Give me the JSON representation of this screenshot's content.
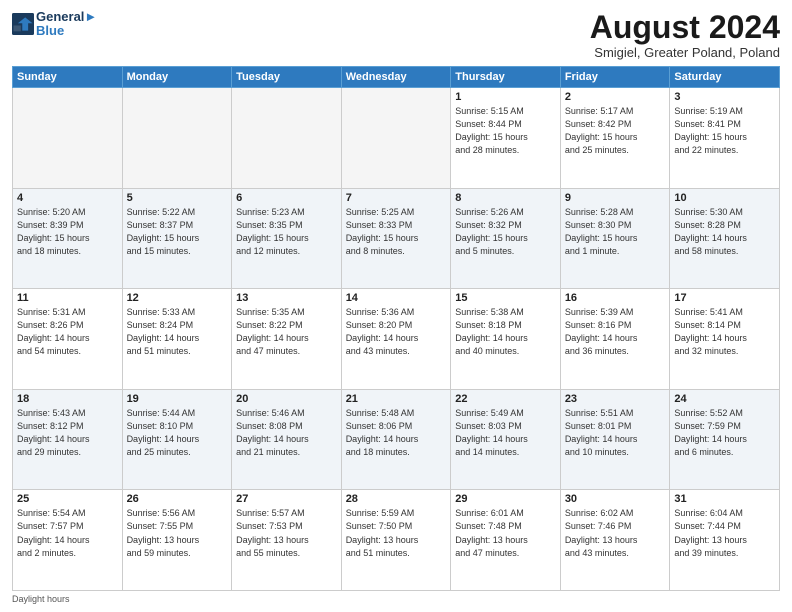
{
  "header": {
    "logo_line1": "General",
    "logo_line2": "Blue",
    "month_title": "August 2024",
    "subtitle": "Smigiel, Greater Poland, Poland"
  },
  "weekdays": [
    "Sunday",
    "Monday",
    "Tuesday",
    "Wednesday",
    "Thursday",
    "Friday",
    "Saturday"
  ],
  "weeks": [
    [
      {
        "day": "",
        "info": ""
      },
      {
        "day": "",
        "info": ""
      },
      {
        "day": "",
        "info": ""
      },
      {
        "day": "",
        "info": ""
      },
      {
        "day": "1",
        "info": "Sunrise: 5:15 AM\nSunset: 8:44 PM\nDaylight: 15 hours\nand 28 minutes."
      },
      {
        "day": "2",
        "info": "Sunrise: 5:17 AM\nSunset: 8:42 PM\nDaylight: 15 hours\nand 25 minutes."
      },
      {
        "day": "3",
        "info": "Sunrise: 5:19 AM\nSunset: 8:41 PM\nDaylight: 15 hours\nand 22 minutes."
      }
    ],
    [
      {
        "day": "4",
        "info": "Sunrise: 5:20 AM\nSunset: 8:39 PM\nDaylight: 15 hours\nand 18 minutes."
      },
      {
        "day": "5",
        "info": "Sunrise: 5:22 AM\nSunset: 8:37 PM\nDaylight: 15 hours\nand 15 minutes."
      },
      {
        "day": "6",
        "info": "Sunrise: 5:23 AM\nSunset: 8:35 PM\nDaylight: 15 hours\nand 12 minutes."
      },
      {
        "day": "7",
        "info": "Sunrise: 5:25 AM\nSunset: 8:33 PM\nDaylight: 15 hours\nand 8 minutes."
      },
      {
        "day": "8",
        "info": "Sunrise: 5:26 AM\nSunset: 8:32 PM\nDaylight: 15 hours\nand 5 minutes."
      },
      {
        "day": "9",
        "info": "Sunrise: 5:28 AM\nSunset: 8:30 PM\nDaylight: 15 hours\nand 1 minute."
      },
      {
        "day": "10",
        "info": "Sunrise: 5:30 AM\nSunset: 8:28 PM\nDaylight: 14 hours\nand 58 minutes."
      }
    ],
    [
      {
        "day": "11",
        "info": "Sunrise: 5:31 AM\nSunset: 8:26 PM\nDaylight: 14 hours\nand 54 minutes."
      },
      {
        "day": "12",
        "info": "Sunrise: 5:33 AM\nSunset: 8:24 PM\nDaylight: 14 hours\nand 51 minutes."
      },
      {
        "day": "13",
        "info": "Sunrise: 5:35 AM\nSunset: 8:22 PM\nDaylight: 14 hours\nand 47 minutes."
      },
      {
        "day": "14",
        "info": "Sunrise: 5:36 AM\nSunset: 8:20 PM\nDaylight: 14 hours\nand 43 minutes."
      },
      {
        "day": "15",
        "info": "Sunrise: 5:38 AM\nSunset: 8:18 PM\nDaylight: 14 hours\nand 40 minutes."
      },
      {
        "day": "16",
        "info": "Sunrise: 5:39 AM\nSunset: 8:16 PM\nDaylight: 14 hours\nand 36 minutes."
      },
      {
        "day": "17",
        "info": "Sunrise: 5:41 AM\nSunset: 8:14 PM\nDaylight: 14 hours\nand 32 minutes."
      }
    ],
    [
      {
        "day": "18",
        "info": "Sunrise: 5:43 AM\nSunset: 8:12 PM\nDaylight: 14 hours\nand 29 minutes."
      },
      {
        "day": "19",
        "info": "Sunrise: 5:44 AM\nSunset: 8:10 PM\nDaylight: 14 hours\nand 25 minutes."
      },
      {
        "day": "20",
        "info": "Sunrise: 5:46 AM\nSunset: 8:08 PM\nDaylight: 14 hours\nand 21 minutes."
      },
      {
        "day": "21",
        "info": "Sunrise: 5:48 AM\nSunset: 8:06 PM\nDaylight: 14 hours\nand 18 minutes."
      },
      {
        "day": "22",
        "info": "Sunrise: 5:49 AM\nSunset: 8:03 PM\nDaylight: 14 hours\nand 14 minutes."
      },
      {
        "day": "23",
        "info": "Sunrise: 5:51 AM\nSunset: 8:01 PM\nDaylight: 14 hours\nand 10 minutes."
      },
      {
        "day": "24",
        "info": "Sunrise: 5:52 AM\nSunset: 7:59 PM\nDaylight: 14 hours\nand 6 minutes."
      }
    ],
    [
      {
        "day": "25",
        "info": "Sunrise: 5:54 AM\nSunset: 7:57 PM\nDaylight: 14 hours\nand 2 minutes."
      },
      {
        "day": "26",
        "info": "Sunrise: 5:56 AM\nSunset: 7:55 PM\nDaylight: 13 hours\nand 59 minutes."
      },
      {
        "day": "27",
        "info": "Sunrise: 5:57 AM\nSunset: 7:53 PM\nDaylight: 13 hours\nand 55 minutes."
      },
      {
        "day": "28",
        "info": "Sunrise: 5:59 AM\nSunset: 7:50 PM\nDaylight: 13 hours\nand 51 minutes."
      },
      {
        "day": "29",
        "info": "Sunrise: 6:01 AM\nSunset: 7:48 PM\nDaylight: 13 hours\nand 47 minutes."
      },
      {
        "day": "30",
        "info": "Sunrise: 6:02 AM\nSunset: 7:46 PM\nDaylight: 13 hours\nand 43 minutes."
      },
      {
        "day": "31",
        "info": "Sunrise: 6:04 AM\nSunset: 7:44 PM\nDaylight: 13 hours\nand 39 minutes."
      }
    ]
  ],
  "footer": "Daylight hours"
}
